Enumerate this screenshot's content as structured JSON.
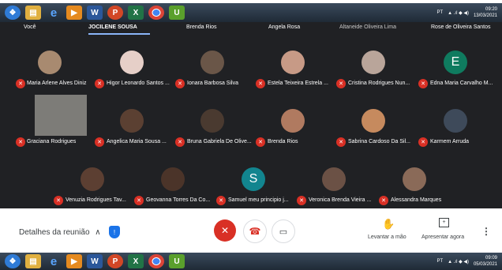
{
  "taskbar_top": {
    "time": "09:20",
    "date": "13/03/2021",
    "lang": "PT"
  },
  "taskbar_bottom": {
    "time": "09:09",
    "date": "05/03/2021",
    "lang": "PT"
  },
  "top_row": [
    {
      "name": "Você"
    },
    {
      "name": "JOCILENE SOUSA"
    },
    {
      "name": "Brenda Rios"
    },
    {
      "name": "Angela Rosa"
    },
    {
      "name": "Altaneide Oliveira Lima"
    },
    {
      "name": "Rose de Oliveira Santos"
    }
  ],
  "row1": [
    {
      "name": "Maria Arlene Alves Diniz",
      "avatar": "photo"
    },
    {
      "name": "Higor Leonardo Santos ...",
      "avatar": "photo"
    },
    {
      "name": "Ionara Barbosa Silva",
      "avatar": "photo"
    },
    {
      "name": "Estela Teixeira Estrela ...",
      "avatar": "photo"
    },
    {
      "name": "Cristina Rodrigues Nun...",
      "avatar": "photo"
    },
    {
      "name": "Edna Maria Carvalho M...",
      "avatar": "E"
    }
  ],
  "row2": [
    {
      "name": "Graciana Rodrigues",
      "avatar": "video"
    },
    {
      "name": "Angelica Maria Sousa ...",
      "avatar": "photo"
    },
    {
      "name": "Bruna Gabriela De Olive...",
      "avatar": "photo"
    },
    {
      "name": "Brenda Rios",
      "avatar": "photo"
    },
    {
      "name": "Sabrina Cardoso Da Sil...",
      "avatar": "photo"
    },
    {
      "name": "Karmem Arruda",
      "avatar": "photo"
    }
  ],
  "row3": [
    {
      "name": "Venuzia Rodrigues Tav...",
      "avatar": "photo"
    },
    {
      "name": "Geovanna Torres Da Co...",
      "avatar": "photo"
    },
    {
      "name": "Samuel meu principio j...",
      "avatar": "S"
    },
    {
      "name": "Veronica Brenda Vieira ...",
      "avatar": "photo"
    },
    {
      "name": "Alessandra Marques",
      "avatar": "photo"
    }
  ],
  "controls": {
    "details_label": "Detalhes da reunião",
    "raise_hand_label": "Levantar a mão",
    "present_label": "Apresentar agora"
  },
  "colors": {
    "meet_bg": "#202124",
    "mic_off": "#d93025",
    "letter_E": "#0f7b5f",
    "letter_S": "#12858f"
  }
}
